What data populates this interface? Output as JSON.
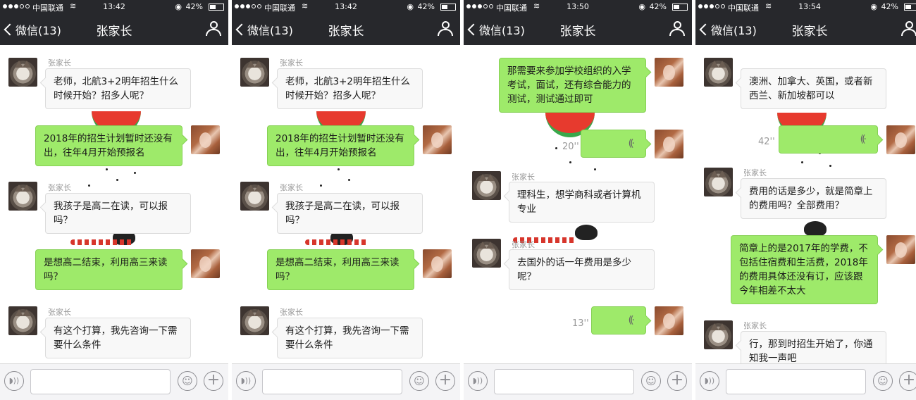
{
  "status": {
    "carrier": "中国联通",
    "battery_text": "42%",
    "battery_level": 0.42
  },
  "navbar": {
    "back_label": "微信(13)",
    "title": "张家长"
  },
  "screens": [
    {
      "time": "13:42",
      "messages": [
        {
          "side": "in",
          "sender": "张家长",
          "text": "老师，北航3+2明年招生什么时候开始？招多人呢？"
        },
        {
          "side": "out",
          "text": "2018年的招生计划暂时还没有出，往年4月开始预报名"
        },
        {
          "side": "in",
          "sender": "张家长",
          "text": "我孩子是高二在读，可以报吗？"
        },
        {
          "side": "out",
          "text": "是想高二结束，利用高三来读吗？"
        },
        {
          "side": "in",
          "sender": "张家长",
          "text": "有这个打算，我先咨询一下需要什么条件"
        }
      ]
    },
    {
      "time": "13:42",
      "messages": [
        {
          "side": "in",
          "sender": "张家长",
          "text": "老师，北航3+2明年招生什么时候开始？招多人呢？"
        },
        {
          "side": "out",
          "text": "2018年的招生计划暂时还没有出，往年4月开始预报名"
        },
        {
          "side": "in",
          "sender": "张家长",
          "text": "我孩子是高二在读，可以报吗？"
        },
        {
          "side": "out",
          "text": "是想高二结束，利用高三来读吗？"
        },
        {
          "side": "in",
          "sender": "张家长",
          "text": "有这个打算，我先咨询一下需要什么条件"
        }
      ]
    },
    {
      "time": "13:50",
      "messages": [
        {
          "side": "out",
          "text": "那需要来参加学校组织的入学考试，面试，还有综合能力的测试，测试通过即可"
        },
        {
          "side": "out",
          "voice": true,
          "duration": "20''"
        },
        {
          "side": "in",
          "sender": "张家长",
          "text": "理科生，想学商科或者计算机专业"
        },
        {
          "side": "in",
          "sender": "张家长",
          "text": "去国外的话一年费用是多少呢？"
        },
        {
          "side": "out",
          "voice": true,
          "duration": "13''"
        }
      ]
    },
    {
      "time": "13:54",
      "messages": [
        {
          "side": "in",
          "sender": "",
          "text": "澳洲、加拿大、英国，或者新西兰、新加坡都可以"
        },
        {
          "side": "out",
          "voice": true,
          "duration": "42''"
        },
        {
          "side": "in",
          "sender": "张家长",
          "text": "费用的话是多少，就是简章上的费用吗？全部费用？"
        },
        {
          "side": "out",
          "text": "简章上的是2017年的学费，不包括住宿费和生活费，2018年的费用具体还没有订，应该跟今年相差不太大"
        },
        {
          "side": "in",
          "sender": "张家长",
          "text": "行，那到时招生开始了，你通知我一声吧"
        }
      ]
    }
  ],
  "inputbar": {
    "voice_icon": "voice-icon",
    "emoji_icon": "emoji-icon",
    "plus_icon": "plus-icon"
  },
  "colors": {
    "bar": "#27282c",
    "out_bubble": "#9eea6a",
    "in_bubble": "#f8f8f8"
  }
}
